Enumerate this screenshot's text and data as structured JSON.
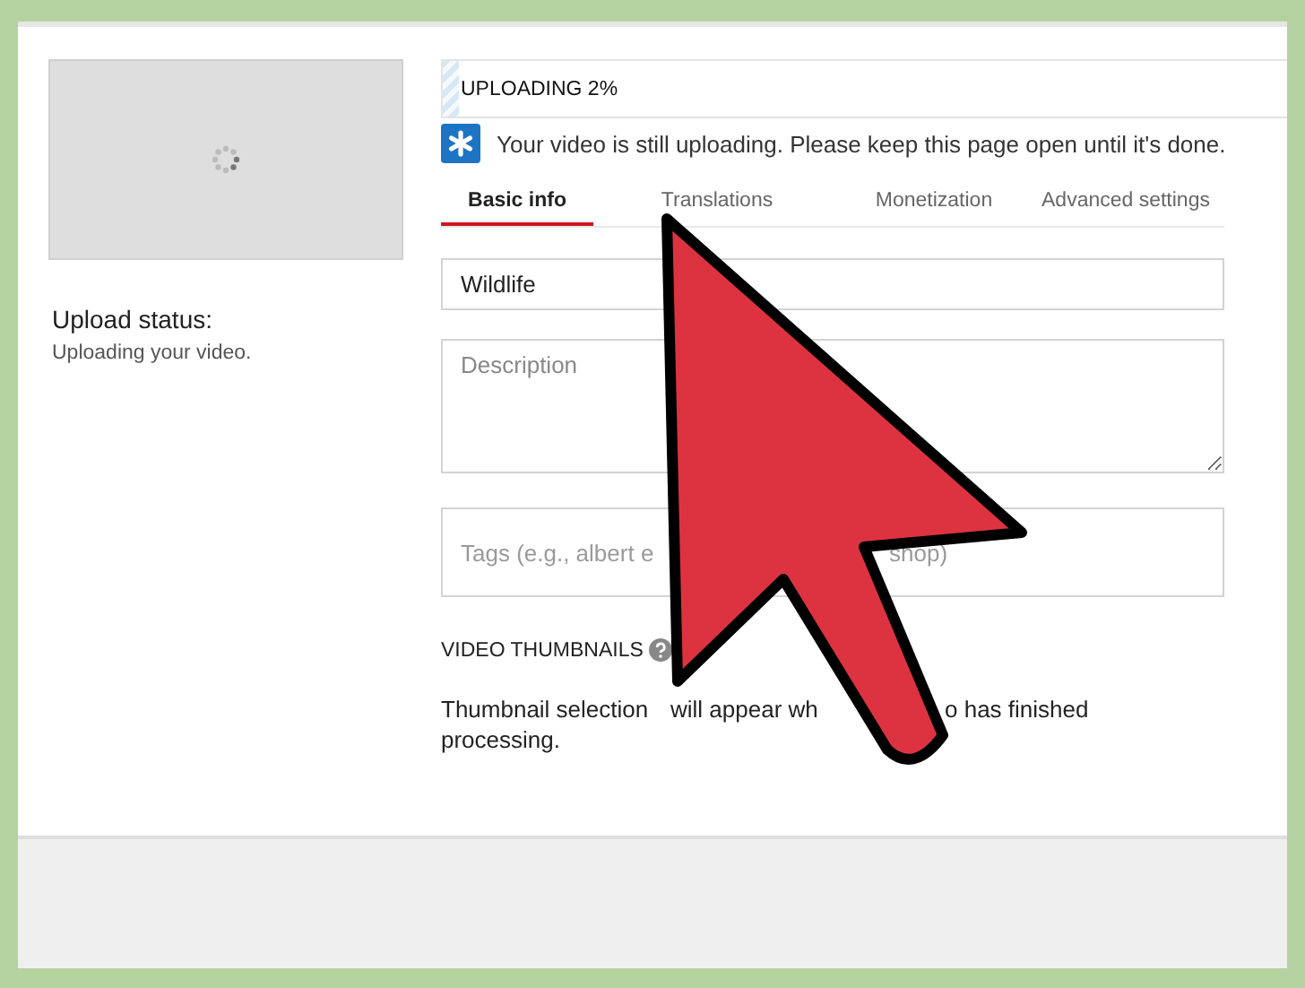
{
  "upload_panel": {
    "status_label": "Upload status:",
    "status_text": "Uploading your video."
  },
  "upload_progress": {
    "label": "UPLOADING 2%",
    "level": 0.02
  },
  "notice": "Your video is still uploading. Please keep this page open until it's done.",
  "tabs": [
    {
      "label": "Basic info",
      "selected": true
    },
    {
      "label": "Translations",
      "selected": false
    },
    {
      "label": "Monetization",
      "selected": false
    },
    {
      "label": "Advanced settings",
      "selected": false
    }
  ],
  "form": {
    "title_value": "Wildlife",
    "description_placeholder": "Description",
    "tags_text": [
      "Tags (e.g., albert e",
      "shop)"
    ]
  },
  "thumbnails": {
    "heading": "VIDEO THUMBNAILS",
    "note_lines": [
      [
        "Thumbnail selection",
        "will appear wh",
        "o has finished"
      ],
      [
        "processing."
      ]
    ]
  }
}
